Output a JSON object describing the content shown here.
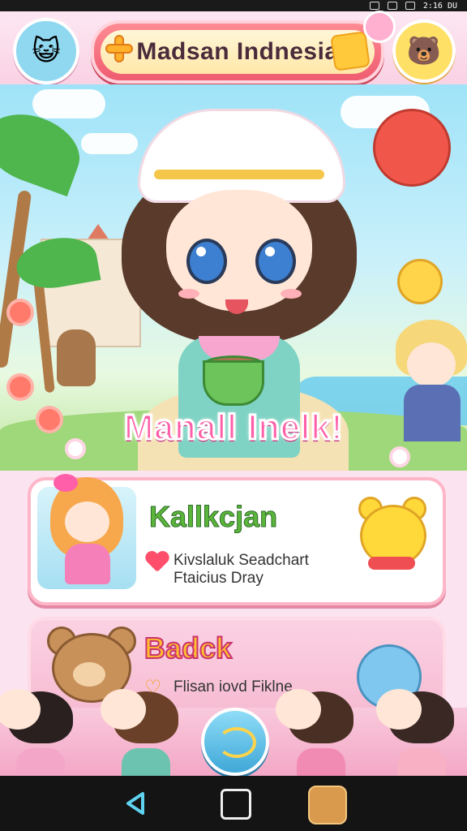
{
  "status_bar": {
    "time": "2:16 DU"
  },
  "header": {
    "title": "Madsan Indnesia"
  },
  "hero": {
    "title": "Manall Inelk!"
  },
  "card1": {
    "title": "Kallkcjan",
    "line1": "Kivslaluk Seadchart",
    "line2": "Ftaicius Dray"
  },
  "card2": {
    "title": "Badck",
    "line1": "Flisan iovd Fiklne"
  },
  "icons": {
    "left_avatar": "cat-face-icon",
    "right_avatar": "bear-face-icon",
    "title_plus": "plus-icon",
    "title_heart": "heart-icon",
    "card1_bullet": "heart-icon",
    "card2_bullet": "heart-outline-icon",
    "center_button": "refresh-icon",
    "nav_back": "back-icon",
    "nav_recents": "recents-icon",
    "nav_app": "app-icon"
  },
  "colors": {
    "title_pill": "#ef5d71",
    "hero_title": "#ff5fa8",
    "card1_title": "#5bb53a",
    "card2_title": "#ffbd2e",
    "nav_bar": "#141414"
  }
}
